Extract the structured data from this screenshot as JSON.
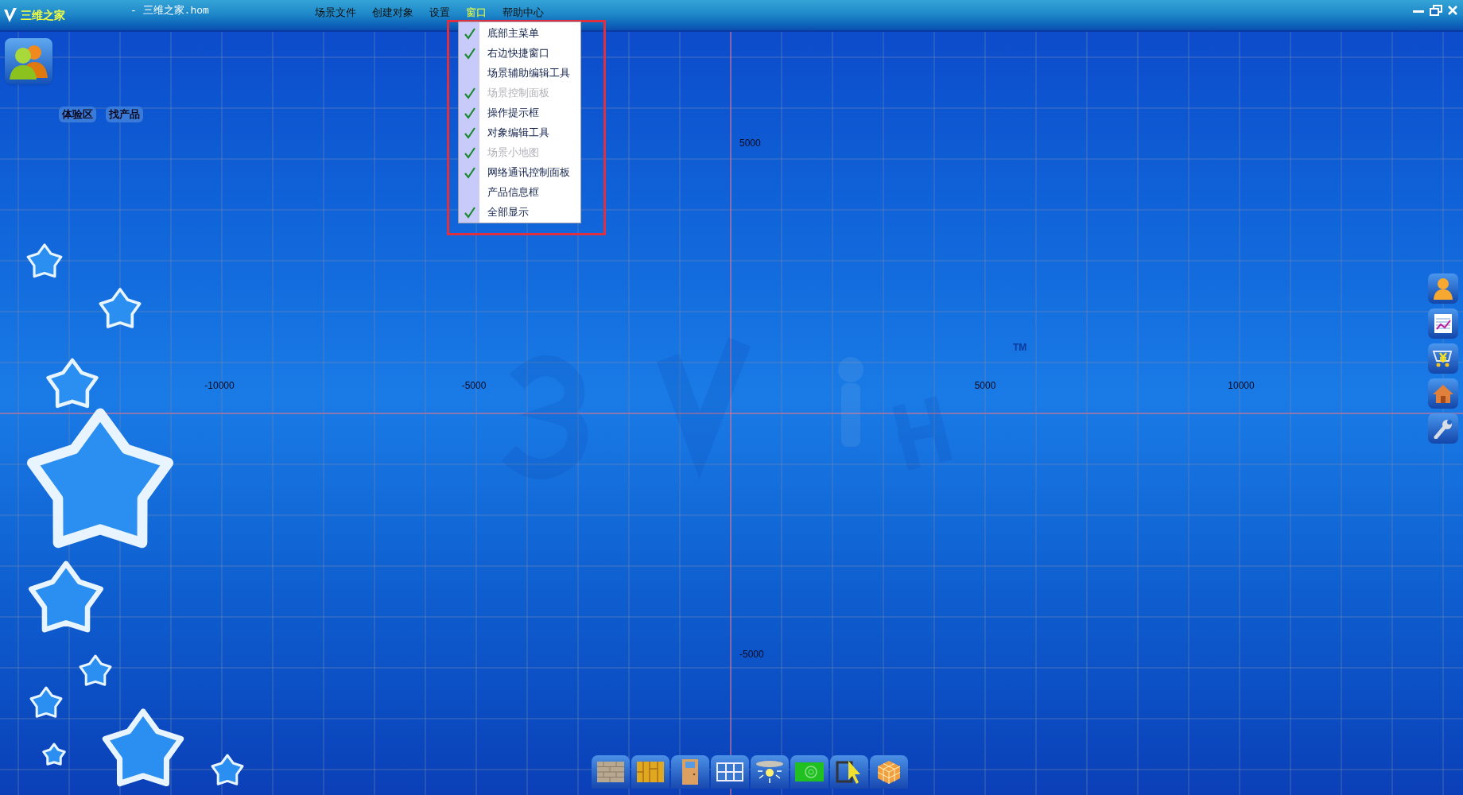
{
  "window": {
    "app_name": "三维之家",
    "document_title": "- 三维之家.hom"
  },
  "menu_bar": [
    {
      "label": "场景文件",
      "selected": false
    },
    {
      "label": "创建对象",
      "selected": false
    },
    {
      "label": "设置",
      "selected": false
    },
    {
      "label": "窗口",
      "selected": true
    },
    {
      "label": "帮助中心",
      "selected": false
    }
  ],
  "window_menu": [
    {
      "label": "底部主菜单",
      "checked": true,
      "disabled": false
    },
    {
      "label": "右边快捷窗口",
      "checked": true,
      "disabled": false
    },
    {
      "label": "场景辅助编辑工具",
      "checked": false,
      "disabled": false
    },
    {
      "label": "场景控制面板",
      "checked": true,
      "disabled": true
    },
    {
      "label": "操作提示框",
      "checked": true,
      "disabled": false
    },
    {
      "label": "对象编辑工具",
      "checked": true,
      "disabled": false
    },
    {
      "label": "场景小地图",
      "checked": true,
      "disabled": true
    },
    {
      "label": "网络通讯控制面板",
      "checked": true,
      "disabled": false
    },
    {
      "label": "产品信息框",
      "checked": false,
      "disabled": false
    },
    {
      "label": "全部显示",
      "checked": true,
      "disabled": false
    }
  ],
  "left_buttons": [
    "体验区",
    "找产品"
  ],
  "canvas": {
    "x_axis_labels": [
      "-10000",
      "-5000",
      "5000",
      "10000"
    ],
    "y_axis_labels": [
      "5000",
      "-5000"
    ],
    "watermark_mark": "TM"
  }
}
